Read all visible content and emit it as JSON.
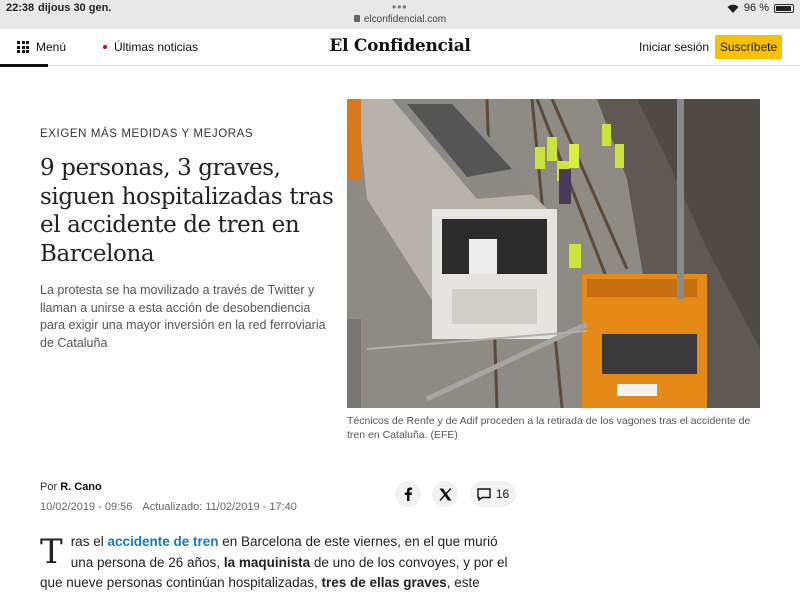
{
  "status_bar": {
    "time": "22:38",
    "date": "dijous 30 gen.",
    "url": "elconfidencial.com",
    "battery": "96 %"
  },
  "header": {
    "menu_label": "Menú",
    "latest_label": "Últimas noticias",
    "logo": "El Confidencial",
    "login_label": "Iniciar sesión",
    "subscribe_label": "Suscríbete",
    "accent_color": "#f6c200"
  },
  "article": {
    "kicker": "EXIGEN MÁS MEDIDAS Y MEJORAS",
    "headline": "9 personas, 3 graves, siguen hospitalizadas tras el accidente de tren en Barcelona",
    "subtitle": "La protesta se ha movilizado a través de Twitter y llaman a unirse a esta acción de desobendiencia para exigir una mayor inversión en la red ferroviaria de Cataluña",
    "caption": "Técnicos de Renfe y de Adif proceden a la retirada de los vagones tras el accidente de tren en Cataluña. (EFE)",
    "byline_prefix": "Por",
    "author": "R. Cano",
    "published": "10/02/2019 - 09:56",
    "updated": "Actualizado: 11/02/2019 - 17:40",
    "comment_count": "16",
    "body": {
      "dropcap": "T",
      "part1": "ras el ",
      "link1": "accidente de tren",
      "part2": " en Barcelona de este viernes, en el que murió una persona de 26 años, ",
      "bold1": "la maquinista",
      "part3": " de uno de los convoyes, y por el que nueve personas continúan hospitalizadas, ",
      "bold2": "tres de ellas graves",
      "part4": ", este"
    }
  },
  "icons": {
    "facebook": "facebook-icon",
    "x": "x-icon",
    "comments": "comment-icon"
  }
}
